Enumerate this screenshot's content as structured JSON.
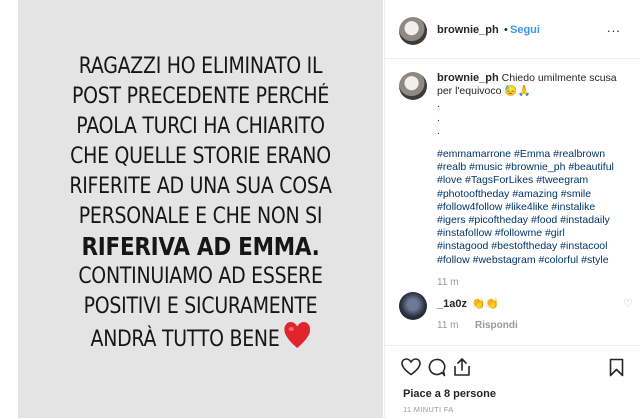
{
  "story": {
    "lines": [
      "RAGAZZI HO ELIMINATO IL",
      "POST PRECEDENTE PERCHÉ",
      "PAOLA TURCI HA CHIARITO",
      "CHE QUELLE STORIE ERANO",
      "RIFERITE AD UNA SUA COSA",
      "PERSONALE E CHE NON SI",
      "RIFERIVA AD EMMA.",
      "CONTINUIAMO AD ESSERE",
      "POSITIVI E SICURAMENTE",
      "ANDRÀ TUTTO BENE"
    ],
    "heart_emoji": "❤️"
  },
  "header": {
    "username": "brownie_ph",
    "separator": "•",
    "follow_label": "Segui",
    "more_label": "..."
  },
  "caption": {
    "username": "brownie_ph",
    "text_line1": "Chiedo umilmente scusa",
    "text_line2": "per l'equivoco 😓🙏",
    "dots": [
      ".",
      ".",
      "."
    ],
    "hashtag_lines": [
      "#emmamarrone #Emma #realbrown",
      "#realb #music #brownie_ph #beautiful",
      "#love #TagsForLikes #tweegram",
      "#photooftheday #amazing #smile",
      "#follow4follow #like4like #instalike",
      "#igers #picoftheday #food #instadaily",
      "#instafollow #followme #girl",
      "#instagood #bestoftheday #instacool",
      "#follow #webstagram #colorful #style"
    ],
    "time": "11 m"
  },
  "comment": {
    "username": "_1a0z",
    "text": "👏👏",
    "time": "11 m",
    "reply_label": "Rispondi",
    "like_icon": "♡"
  },
  "footer": {
    "likes": "Piace a 8 persone",
    "time_ago": "11 MINUTI FA"
  }
}
